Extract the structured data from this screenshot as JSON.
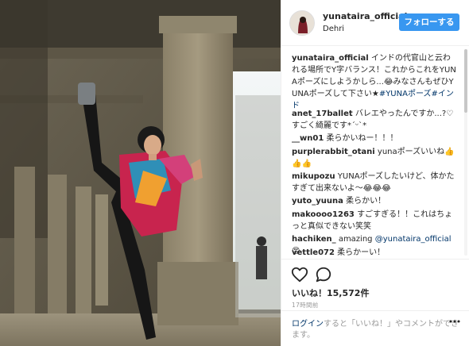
{
  "post": {
    "username": "yunataira_official",
    "location": "Dehri",
    "follow_label": "フォローする"
  },
  "comments": [
    {
      "user": "yunataira_official",
      "text": "インドの代官山と云われる場所でY字バランス！これからこれをYUNAポーズにしようかしら...😂みなさんもぜひYUNAポーズして下さい★",
      "tags": "#YUNAポーズ#インド"
    },
    {
      "user": "anet_17ballet",
      "text": "バレエやったんですか...?♡すごく綺麗です*ˊᵕˋ*"
    },
    {
      "user": "__wn01",
      "text": "柔らかいねー！！！"
    },
    {
      "user": "purplerabbit_otani",
      "text": "yunaポーズいいね👍👍👍"
    },
    {
      "user": "mikupozu",
      "text": "YUNAポーズしたいけど、体かたすぎて出来ないよ〜😂😂😂"
    },
    {
      "user": "yuto_yuuna",
      "text": "柔らかい！"
    },
    {
      "user": "makoooo1263",
      "text": "すごすぎる！！これはちょっと真似できない笑笑"
    },
    {
      "user": "hachiken_",
      "text": "amazing",
      "mention": "@yunataira_official",
      "emoji": "😍"
    },
    {
      "user": "vettle072",
      "text": "柔らかーい！"
    }
  ],
  "actions": {
    "heart_icon": "heart-outline",
    "comment_icon": "comment-bubble",
    "likes_label": "いいね！",
    "likes_count": "15,572件",
    "time": "17時間前"
  },
  "login": {
    "link": "ログイン",
    "text": "すると「いいね！」やコメントができます。"
  }
}
